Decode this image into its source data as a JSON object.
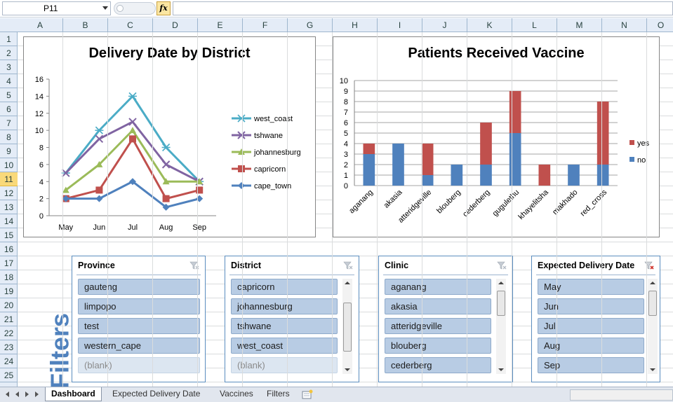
{
  "formula_bar": {
    "name_box": "P11",
    "fx_label": "fx",
    "formula": ""
  },
  "columns": [
    "A",
    "B",
    "C",
    "D",
    "E",
    "F",
    "G",
    "H",
    "I",
    "J",
    "K",
    "L",
    "M",
    "N",
    "O"
  ],
  "rows": [
    "1",
    "2",
    "3",
    "4",
    "5",
    "6",
    "7",
    "8",
    "9",
    "10",
    "11",
    "12",
    "13",
    "14",
    "15",
    "16",
    "17",
    "18",
    "19",
    "20",
    "21",
    "22",
    "23",
    "24",
    "25"
  ],
  "selected_row": "11",
  "filters_label": "Filters",
  "line_chart": {
    "chart_data": {
      "type": "line",
      "title": "Delivery Date by District",
      "categories": [
        "May",
        "Jun",
        "Jul",
        "Aug",
        "Sep"
      ],
      "ylim": [
        0,
        16
      ],
      "yticks": [
        "0",
        "2",
        "4",
        "6",
        "8",
        "10",
        "12",
        "14",
        "16"
      ],
      "grid": false,
      "legend_position": "right",
      "series": [
        {
          "name": "west_coast",
          "values": [
            5,
            10,
            14,
            8,
            4
          ],
          "color": "#4bacc6",
          "marker": "star"
        },
        {
          "name": "tshwane",
          "values": [
            5,
            9,
            11,
            6,
            4
          ],
          "color": "#8064a2",
          "marker": "x"
        },
        {
          "name": "johannesburg",
          "values": [
            3,
            6,
            10,
            4,
            4
          ],
          "color": "#9bbb59",
          "marker": "triangle"
        },
        {
          "name": "capricorn",
          "values": [
            2,
            3,
            9,
            2,
            3
          ],
          "color": "#c0504d",
          "marker": "square"
        },
        {
          "name": "cape_town",
          "values": [
            2,
            2,
            4,
            1,
            2
          ],
          "color": "#4f81bd",
          "marker": "diamond"
        }
      ]
    }
  },
  "bar_chart": {
    "chart_data": {
      "type": "bar",
      "stacked": true,
      "title": "Patients Received Vaccine",
      "categories": [
        "aganang",
        "akasia",
        "atteridgeville",
        "blouberg",
        "cederberg",
        "gugulethu",
        "khayelitsha",
        "makhado",
        "red_cross"
      ],
      "ylim": [
        0,
        10
      ],
      "yticks": [
        "0",
        "1",
        "2",
        "3",
        "4",
        "5",
        "6",
        "7",
        "8",
        "9",
        "10"
      ],
      "grid": true,
      "legend_position": "right",
      "series": [
        {
          "name": "no",
          "values": [
            3,
            4,
            1,
            2,
            2,
            5,
            0,
            2,
            2
          ],
          "color": "#4f81bd"
        },
        {
          "name": "yes",
          "values": [
            1,
            0,
            3,
            0,
            4,
            4,
            2,
            0,
            6
          ],
          "color": "#c0504d"
        }
      ]
    }
  },
  "slicers": {
    "province": {
      "title": "Province",
      "items": [
        "gauteng",
        "limpopo",
        "test",
        "western_cape",
        "(blank)"
      ]
    },
    "district": {
      "title": "District",
      "items": [
        "capricorn",
        "johannesburg",
        "tshwane",
        "west_coast",
        "(blank)"
      ]
    },
    "clinic": {
      "title": "Clinic",
      "items": [
        "aganang",
        "akasia",
        "atteridgeville",
        "blouberg",
        "cederberg"
      ]
    },
    "expected_delivery_date": {
      "title": "Expected Delivery Date",
      "items": [
        "May",
        "Jun",
        "Jul",
        "Aug",
        "Sep"
      ]
    }
  },
  "sheet_tabs": [
    "Dashboard",
    "Expected Delivery Date",
    "Vaccines",
    "Filters"
  ],
  "active_tab": "Dashboard"
}
